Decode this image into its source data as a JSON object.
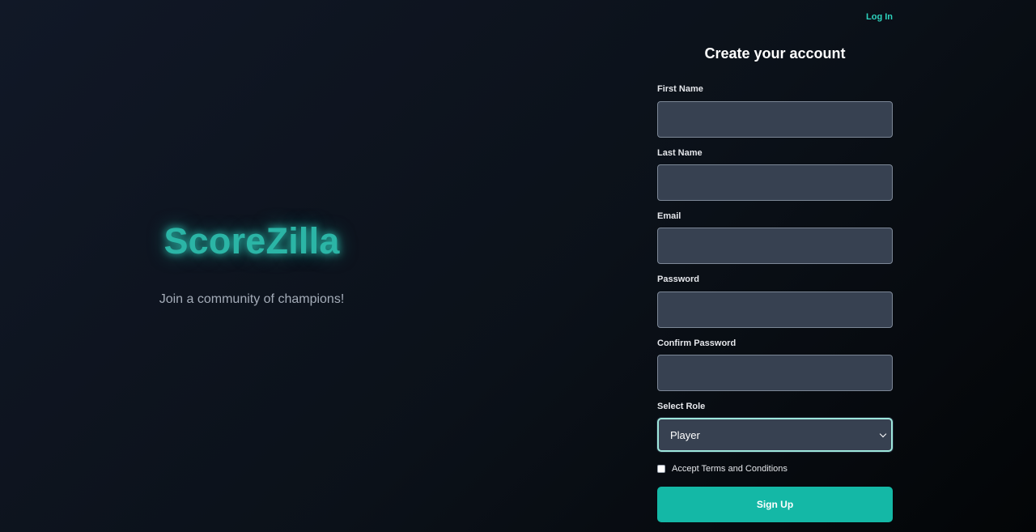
{
  "header": {
    "login_link": "Log In"
  },
  "brand": {
    "name": "ScoreZilla",
    "tagline": "Join a community of champions!"
  },
  "form": {
    "title": "Create your account",
    "fields": {
      "first_name": {
        "label": "First Name",
        "value": ""
      },
      "last_name": {
        "label": "Last Name",
        "value": ""
      },
      "email": {
        "label": "Email",
        "value": ""
      },
      "password": {
        "label": "Password",
        "value": ""
      },
      "confirm_password": {
        "label": "Confirm Password",
        "value": ""
      }
    },
    "role": {
      "label": "Select Role",
      "selected": "Player"
    },
    "terms": {
      "label": "Accept Terms and Conditions",
      "checked": false
    },
    "submit_label": "Sign Up"
  },
  "colors": {
    "accent": "#14b8a6",
    "brand_glow": "#2dd4bf",
    "input_bg": "#374151",
    "page_bg": "#0b1119"
  }
}
